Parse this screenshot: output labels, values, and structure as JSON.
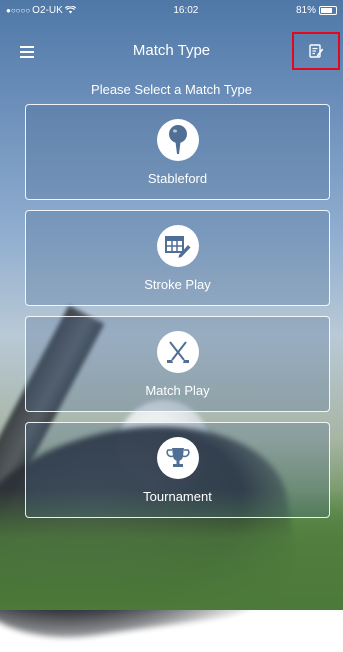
{
  "status_bar": {
    "carrier": "O2-UK",
    "time": "16:02",
    "battery": "81%"
  },
  "nav": {
    "title": "Match Type",
    "menu_icon": "hamburger-menu-icon",
    "edit_icon": "edit-note-icon",
    "highlight_color": "#e2071c"
  },
  "subtitle": "Please Select a Match Type",
  "match_types": [
    {
      "label": "Stableford",
      "icon": "golf-tee-icon"
    },
    {
      "label": "Stroke Play",
      "icon": "scorecard-pencil-icon"
    },
    {
      "label": "Match Play",
      "icon": "crossed-clubs-icon"
    },
    {
      "label": "Tournament",
      "icon": "trophy-icon"
    }
  ]
}
